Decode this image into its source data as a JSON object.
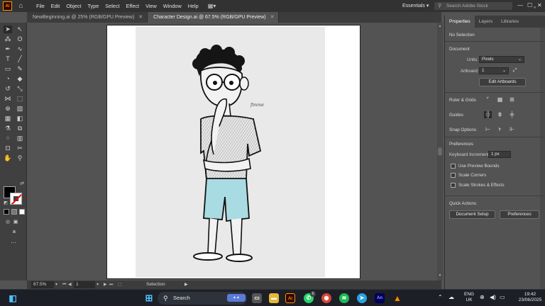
{
  "menubar": {
    "app_logo": "Ai",
    "items": [
      "File",
      "Edit",
      "Object",
      "Type",
      "Select",
      "Effect",
      "View",
      "Window",
      "Help"
    ],
    "workspace": "Essentials",
    "stock_search_placeholder": "Search Adobe Stock",
    "icons": [
      "home-icon",
      "workspace-switcher-icon",
      "minimize-icon",
      "maximize-icon",
      "close-icon"
    ]
  },
  "tabs": [
    {
      "label": "NewBeginning.ai @ 25% (RGB/GPU Preview)",
      "active": false
    },
    {
      "label": "Character Design.ai @ 67.5% (RGB/GPU Preview)",
      "active": true
    }
  ],
  "statusbar": {
    "zoom": "67.5%",
    "artboard_number": "1",
    "tool_status": "Selection"
  },
  "panel": {
    "tabs": [
      "Properties",
      "Layers",
      "Libraries"
    ],
    "selection_state": "No Selection",
    "document": {
      "heading": "Document",
      "units_label": "Units:",
      "units_value": "Pixels",
      "artboard_label": "Artboard:",
      "artboard_value": "1",
      "edit_artboards": "Edit Artboards"
    },
    "ruler_grids": "Ruler & Grids",
    "guides": "Guides",
    "snap_options": "Snap Options",
    "preferences": {
      "heading": "Preferences",
      "keyboard_increment_label": "Keyboard Increment:",
      "keyboard_increment_value": "1 px",
      "checkboxes": [
        "Use Preview Bounds",
        "Scale Corners",
        "Scale Strokes & Effects"
      ]
    },
    "quick_actions": {
      "heading": "Quick Actions",
      "document_setup": "Document Setup",
      "preferences": "Preferences"
    }
  },
  "colors": {
    "fill": "#000000",
    "stroke": "#ffffff",
    "accent": "#ff9a00",
    "shorts": "#a9dbe3"
  },
  "taskbar": {
    "search_placeholder": "Search",
    "language_line1": "ENG",
    "language_line2": "UK",
    "time": "19:42",
    "date": "23/06/2025",
    "whatsapp_badge": "6"
  }
}
